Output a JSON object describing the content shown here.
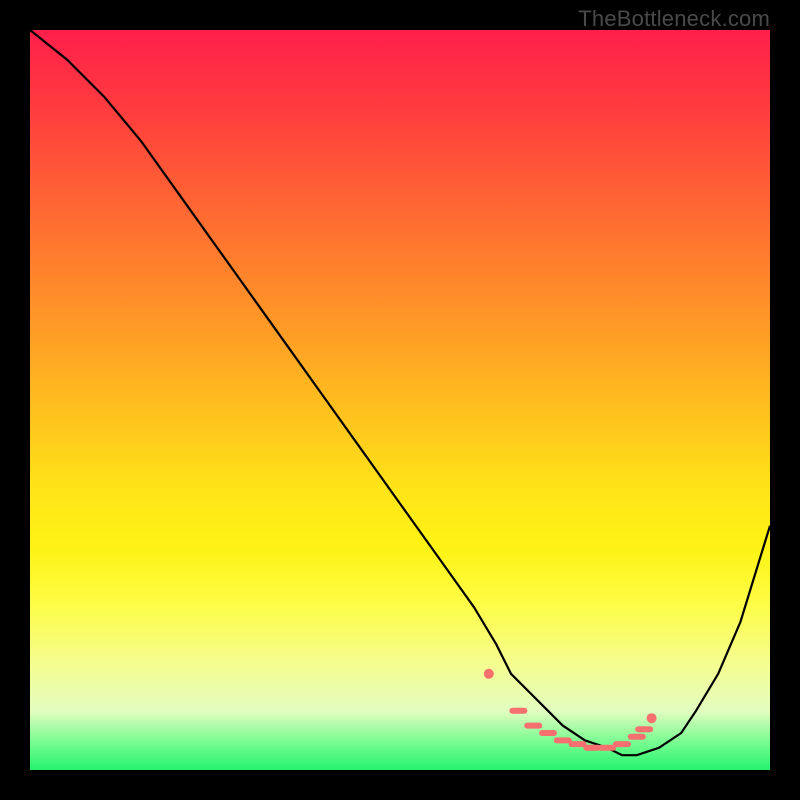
{
  "watermark": "TheBottleneck.com",
  "chart_data": {
    "type": "line",
    "title": "",
    "xlabel": "",
    "ylabel": "",
    "xlim": [
      0,
      100
    ],
    "ylim": [
      0,
      100
    ],
    "grid": false,
    "legend": false,
    "series": [
      {
        "name": "curve",
        "color": "#000000",
        "x": [
          0,
          5,
          10,
          15,
          20,
          25,
          30,
          35,
          40,
          45,
          50,
          55,
          60,
          63,
          65,
          68,
          70,
          72,
          75,
          78,
          80,
          82,
          85,
          88,
          90,
          93,
          96,
          100
        ],
        "values": [
          100,
          96,
          91,
          85,
          78,
          71,
          64,
          57,
          50,
          43,
          36,
          29,
          22,
          17,
          13,
          10,
          8,
          6,
          4,
          3,
          2,
          2,
          3,
          5,
          8,
          13,
          20,
          33
        ]
      },
      {
        "name": "marker-dots",
        "color": "#f6706f",
        "type": "scatter",
        "x": [
          62,
          66,
          68,
          70,
          72,
          74,
          76,
          78,
          80,
          82,
          83,
          84
        ],
        "values": [
          13,
          8,
          6,
          5,
          4,
          3.5,
          3,
          3,
          3.5,
          4.5,
          5.5,
          7
        ]
      }
    ]
  }
}
